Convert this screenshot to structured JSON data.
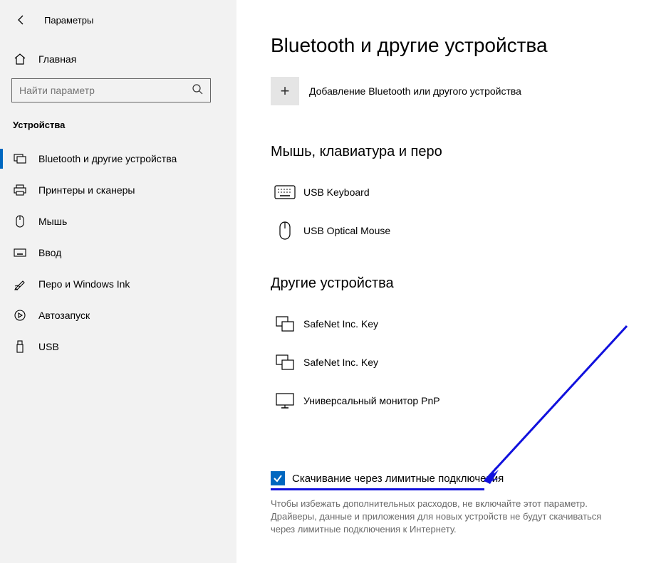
{
  "window": {
    "title": "Параметры"
  },
  "sidebar": {
    "home": "Главная",
    "search_placeholder": "Найти параметр",
    "category": "Устройства",
    "items": [
      {
        "label": "Bluetooth и другие устройства"
      },
      {
        "label": "Принтеры и сканеры"
      },
      {
        "label": "Мышь"
      },
      {
        "label": "Ввод"
      },
      {
        "label": "Перо и Windows Ink"
      },
      {
        "label": "Автозапуск"
      },
      {
        "label": "USB"
      }
    ]
  },
  "main": {
    "heading": "Bluetooth и другие устройства",
    "add_label": "Добавление Bluetooth или другого устройства",
    "section1_heading": "Мышь, клавиатура и перо",
    "section1_devices": [
      {
        "label": "USB Keyboard"
      },
      {
        "label": "USB Optical Mouse"
      }
    ],
    "section2_heading": "Другие устройства",
    "section2_devices": [
      {
        "label": "SafeNet Inc. Key"
      },
      {
        "label": "SafeNet Inc. Key"
      },
      {
        "label": "Универсальный монитор PnP"
      }
    ],
    "metered": {
      "checkbox_label": "Скачивание через лимитные подключения",
      "description": "Чтобы избежать дополнительных расходов, не включайте этот параметр. Драйверы, данные и приложения для новых устройств не будут скачиваться через лимитные подключения к Интернету."
    }
  }
}
